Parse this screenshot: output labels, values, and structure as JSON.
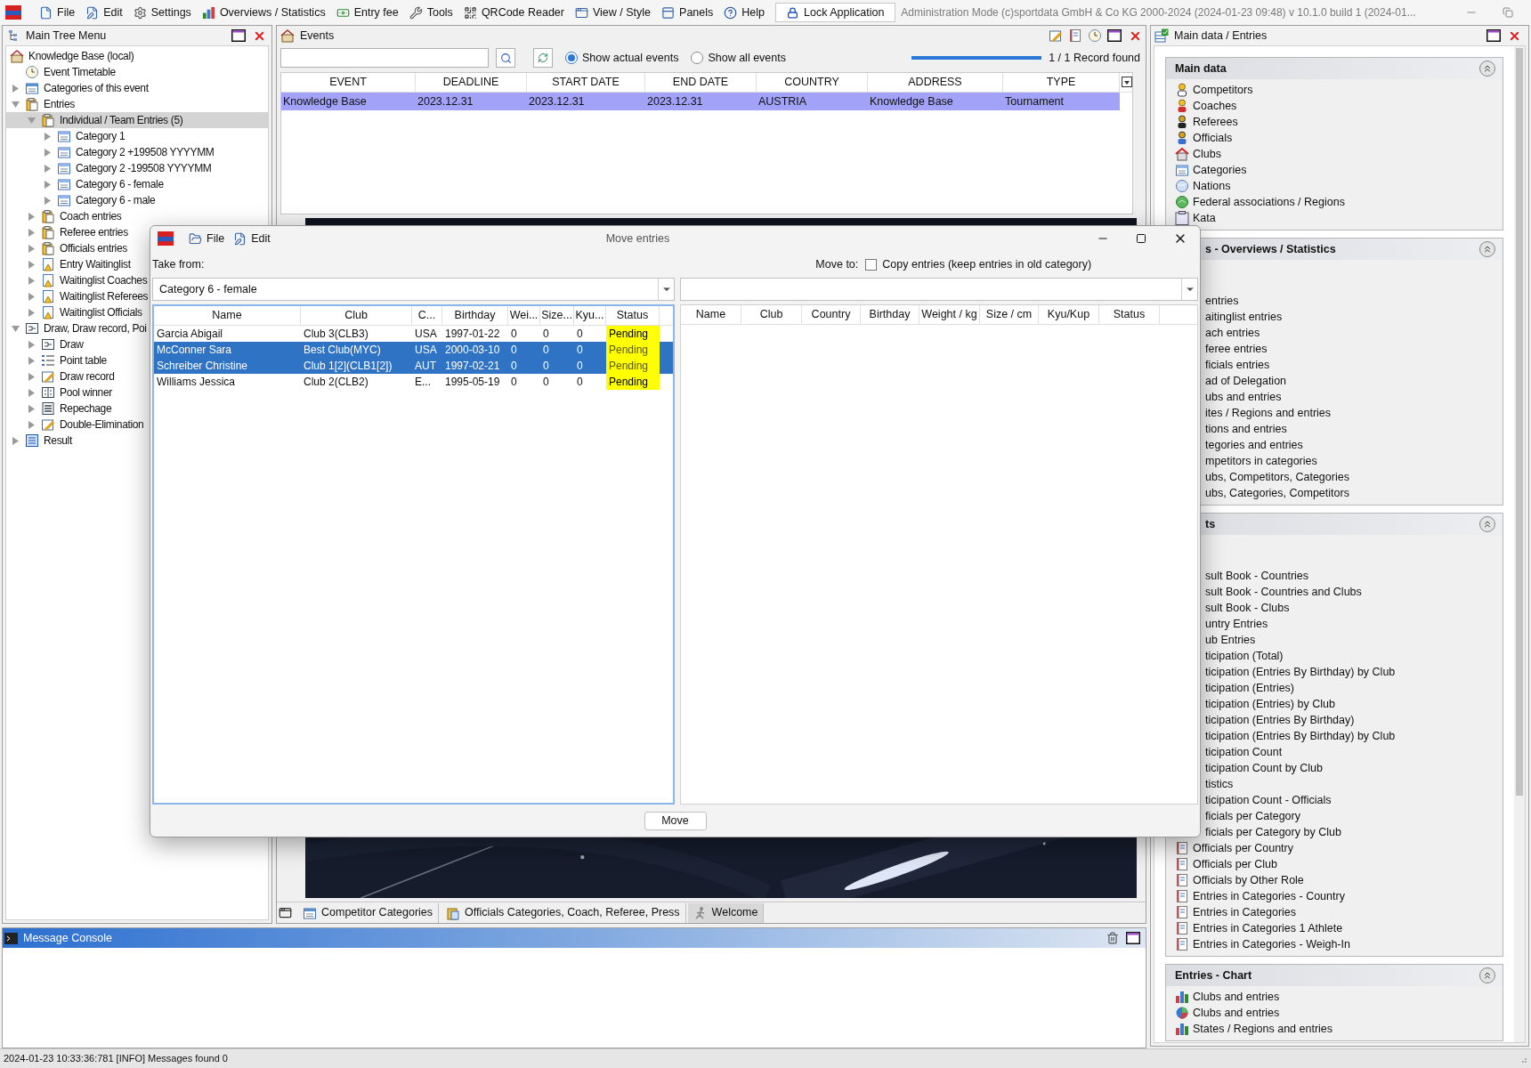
{
  "menu": [
    {
      "label": "File",
      "kind": "file"
    },
    {
      "label": "Edit",
      "kind": "edit"
    },
    {
      "label": "Settings",
      "kind": "settings"
    },
    {
      "label": "Overviews / Statistics",
      "kind": "chart"
    },
    {
      "label": "Entry fee",
      "kind": "money"
    },
    {
      "label": "Tools",
      "kind": "tools"
    },
    {
      "label": "QRCode Reader",
      "kind": "qr"
    },
    {
      "label": "View / Style",
      "kind": "view"
    },
    {
      "label": "Panels",
      "kind": "panels"
    },
    {
      "label": "Help",
      "kind": "help"
    }
  ],
  "lock_button": "Lock Application",
  "app_info": "Administration Mode (c)sportdata GmbH & Co KG 2000-2024 (2024-01-23 09:48)   v 10.1.0 build 1 (2024-01...",
  "tree_panel": {
    "title": "Main Tree Menu",
    "nodes": [
      {
        "label": "Knowledge Base (local)",
        "kind": "home",
        "selected": false,
        "children": [
          {
            "label": "Event Timetable",
            "kind": "clock",
            "selected": false
          },
          {
            "label": "Categories of this event",
            "kind": "categories",
            "selected": false,
            "expanded": false
          },
          {
            "label": "Entries",
            "kind": "clipboard",
            "selected": false,
            "expanded": true,
            "children": [
              {
                "label": "Individual / Team Entries (5)",
                "kind": "clipboard",
                "selected": true,
                "expanded": true,
                "children": [
                  {
                    "label": "Category 1",
                    "kind": "category",
                    "selected": false,
                    "expanded": false
                  },
                  {
                    "label": "Category 2 +199508 YYYYMM",
                    "kind": "category",
                    "selected": false,
                    "expanded": false
                  },
                  {
                    "label": "Category 2 -199508 YYYYMM",
                    "kind": "category",
                    "selected": false,
                    "expanded": false
                  },
                  {
                    "label": "Category 6 - female",
                    "kind": "category",
                    "selected": false,
                    "expanded": false
                  },
                  {
                    "label": "Category 6 - male",
                    "kind": "category",
                    "selected": false,
                    "expanded": false
                  }
                ]
              },
              {
                "label": "Coach entries",
                "kind": "clipboard",
                "selected": false,
                "expanded": false
              },
              {
                "label": "Referee entries",
                "kind": "clipboard",
                "selected": false,
                "expanded": false
              },
              {
                "label": "Officials entries",
                "kind": "clipboard",
                "selected": false,
                "expanded": false
              },
              {
                "label": "Entry Waitinglist",
                "kind": "warning",
                "selected": false,
                "expanded": false
              },
              {
                "label": "Waitinglist Coaches",
                "kind": "warning",
                "selected": false,
                "expanded": false
              },
              {
                "label": "Waitinglist Referees",
                "kind": "warning",
                "selected": false,
                "expanded": false
              },
              {
                "label": "Waitinglist Officials",
                "kind": "warning",
                "selected": false,
                "expanded": false
              }
            ]
          },
          {
            "label": "Draw, Draw record, Poi",
            "kind": "draw",
            "selected": false,
            "expanded": true,
            "children": [
              {
                "label": "Draw",
                "kind": "draw",
                "selected": false,
                "expanded": false
              },
              {
                "label": "Point table",
                "kind": "points",
                "selected": false,
                "expanded": false
              },
              {
                "label": "Draw record",
                "kind": "pencil",
                "selected": false,
                "expanded": false
              },
              {
                "label": "Pool winner",
                "kind": "pool",
                "selected": false,
                "expanded": false
              },
              {
                "label": "Repechage",
                "kind": "repechage",
                "selected": false,
                "expanded": false
              },
              {
                "label": "Double-Elimination",
                "kind": "pencil",
                "selected": false,
                "expanded": false
              }
            ]
          },
          {
            "label": "Result",
            "kind": "result",
            "selected": false,
            "expanded": false
          }
        ]
      }
    ]
  },
  "events_panel": {
    "title": "Events",
    "filters": [
      {
        "label": "Show actual events",
        "selected": true
      },
      {
        "label": "Show all events",
        "selected": false
      }
    ],
    "progress": {
      "level": 1
    },
    "record_count": "1 / 1 Record found",
    "columns": [
      "EVENT",
      "DEADLINE",
      "START DATE",
      "END DATE",
      "COUNTRY",
      "ADDRESS",
      "TYPE"
    ],
    "rows": [
      {
        "selected": true,
        "cells": [
          "Knowledge Base",
          "2023.12.31",
          "2023.12.31",
          "2023.12.31",
          "AUSTRIA",
          "Knowledge Base",
          "Tournament"
        ]
      }
    ]
  },
  "bottom_tabs": [
    {
      "label": "Competitor Categories",
      "kind": "categories",
      "selected": false
    },
    {
      "label": "Officials Categories, Coach, Referee, Press",
      "kind": "officials",
      "selected": false
    },
    {
      "label": "Welcome",
      "kind": "runner",
      "selected": true
    }
  ],
  "console": {
    "title": "Message Console"
  },
  "status_bar": "2024-01-23 10:33:36:781 [INFO] Messages found 0",
  "right_panel": {
    "title": "Main data / Entries",
    "sections": [
      {
        "title": "Main data",
        "items": [
          {
            "text": "Competitors",
            "kind": "competitor"
          },
          {
            "text": "Coaches",
            "kind": "coach"
          },
          {
            "text": "Referees",
            "kind": "referee"
          },
          {
            "text": "Officials",
            "kind": "official"
          },
          {
            "text": "Clubs",
            "kind": "club"
          },
          {
            "text": "Categories",
            "kind": "category"
          },
          {
            "text": "Nations",
            "kind": "nation"
          },
          {
            "text": "Federal associations / Regions",
            "kind": "federation"
          },
          {
            "text": "Kata",
            "kind": "kata"
          }
        ]
      },
      {
        "title": "s - Overviews / Statistics",
        "clipped": true,
        "items": [
          {
            "text": "entries",
            "clipped": true
          },
          {
            "text": "aitinglist entries",
            "clipped": true
          },
          {
            "text": "ach entries",
            "clipped": true
          },
          {
            "text": "feree entries",
            "clipped": true
          },
          {
            "text": "ficials entries",
            "clipped": true
          },
          {
            "text": "ad of Delegation",
            "clipped": true
          },
          {
            "text": "ubs and entries",
            "clipped": true
          },
          {
            "text": "ites / Regions and entries",
            "clipped": true
          },
          {
            "text": "tions and entries",
            "clipped": true
          },
          {
            "text": "tegories and entries",
            "clipped": true
          },
          {
            "text": "mpetitors in categories",
            "clipped": true
          },
          {
            "text": "ubs, Competitors, Categories",
            "clipped": true
          },
          {
            "text": "ubs, Categories, Competitors",
            "clipped": true
          }
        ]
      },
      {
        "title": "ts",
        "clipped": true,
        "items": [
          {
            "text": "sult Book - Countries",
            "clipped": true
          },
          {
            "text": "sult Book - Countries and Clubs",
            "clipped": true
          },
          {
            "text": "sult Book - Clubs",
            "clipped": true
          },
          {
            "text": "untry Entries",
            "clipped": true
          },
          {
            "text": "ub Entries",
            "clipped": true
          },
          {
            "text": "ticipation (Total)",
            "clipped": true
          },
          {
            "text": "ticipation (Entries By Birthday) by Club",
            "clipped": true
          },
          {
            "text": "ticipation (Entries)",
            "clipped": true
          },
          {
            "text": "ticipation (Entries) by Club",
            "clipped": true
          },
          {
            "text": "ticipation (Entries By Birthday)",
            "clipped": true
          },
          {
            "text": "ticipation (Entries By Birthday) by Club",
            "clipped": true
          },
          {
            "text": "ticipation Count",
            "clipped": true
          },
          {
            "text": "ticipation Count by Club",
            "clipped": true
          },
          {
            "text": "tistics",
            "clipped": true
          },
          {
            "text": "ticipation Count - Officials",
            "clipped": true
          },
          {
            "text": "ficials per Category",
            "clipped": true
          },
          {
            "text": "ficials per Category by Club",
            "clipped": true
          },
          {
            "text": "Officials per Country",
            "kind": "report"
          },
          {
            "text": "Officials per Club",
            "kind": "report"
          },
          {
            "text": "Officials by Other Role",
            "kind": "report"
          },
          {
            "text": "Entries in Categories - Country",
            "kind": "report"
          },
          {
            "text": "Entries in Categories",
            "kind": "report"
          },
          {
            "text": "Entries in Categories 1 Athlete",
            "kind": "report"
          },
          {
            "text": "Entries in Categories - Weigh-In",
            "kind": "report"
          }
        ]
      },
      {
        "title": "Entries - Chart",
        "items": [
          {
            "text": "Clubs and entries",
            "kind": "bar"
          },
          {
            "text": "Clubs and entries",
            "kind": "pie"
          },
          {
            "text": "States / Regions and entries",
            "kind": "bar"
          }
        ]
      }
    ]
  },
  "dialog": {
    "title": "Move entries",
    "menu": [
      {
        "label": "File",
        "kind": "folder"
      },
      {
        "label": "Edit",
        "kind": "edit"
      }
    ],
    "take_from_label": "Take from:",
    "take_from_value": "Category 6 - female",
    "move_to_label": "Move to:",
    "copy_option": {
      "label": "Copy entries (keep entries in old category)",
      "checked": false
    },
    "left_columns": [
      "Name",
      "Club",
      "C...",
      "Birthday",
      "Wei...",
      "Size...",
      "Kyu...",
      "Status"
    ],
    "left_rows": [
      {
        "selected": false,
        "cells": [
          "Garcia Abigail",
          "Club 3(CLB3)",
          "USA",
          "1997-01-22",
          "0",
          "0",
          "0",
          "Pending"
        ]
      },
      {
        "selected": true,
        "cells": [
          "McConner Sara",
          "Best Club(MYC)",
          "USA",
          "2000-03-10",
          "0",
          "0",
          "0",
          "Pending"
        ]
      },
      {
        "selected": true,
        "cells": [
          "Schreiber Christine",
          "Club 1[2](CLB1[2])",
          "AUT",
          "1997-02-21",
          "0",
          "0",
          "0",
          "Pending"
        ]
      },
      {
        "selected": false,
        "cells": [
          "Williams Jessica",
          "Club 2(CLB2)",
          "E...",
          "1995-05-19",
          "0",
          "0",
          "0",
          "Pending"
        ]
      }
    ],
    "right_columns": [
      "Name",
      "Club",
      "Country",
      "Birthday",
      "Weight / kg",
      "Size / cm",
      "Kyu/Kup",
      "Status"
    ],
    "move_button": "Move"
  }
}
